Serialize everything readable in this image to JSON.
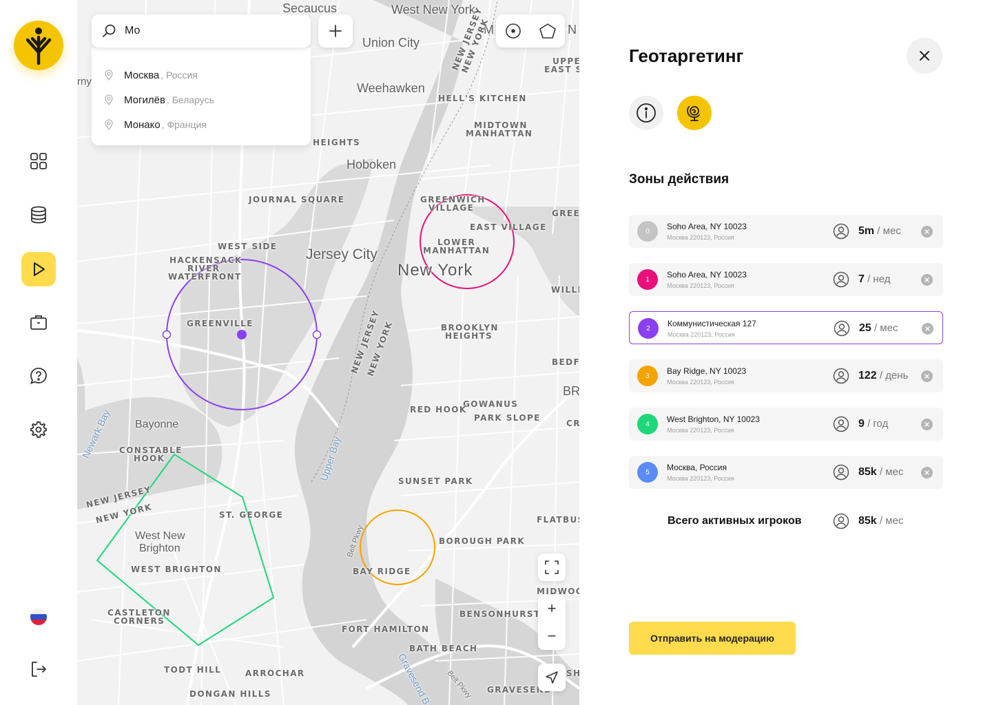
{
  "sidebar": {
    "logo": "app-logo",
    "items": [
      {
        "icon": "grid-icon",
        "active": false
      },
      {
        "icon": "database-icon",
        "active": false
      },
      {
        "icon": "play-icon",
        "active": true
      },
      {
        "icon": "briefcase-icon",
        "active": false
      },
      {
        "icon": "help-chat-icon",
        "active": false
      },
      {
        "icon": "gear-icon",
        "active": false
      }
    ],
    "language_flag": "flag-ru-icon",
    "logout": "logout-icon"
  },
  "map": {
    "search": {
      "value": "Мо",
      "placeholder": ""
    },
    "suggestions": [
      {
        "name": "Москва",
        "country": ", Россия"
      },
      {
        "name": "Могилёв",
        "country": ", Беларусь"
      },
      {
        "name": "Монако",
        "country": ", Франция"
      }
    ],
    "labels": {
      "secaucus": "Secaucus",
      "west_new_york": "West New York",
      "union_city": "Union City",
      "weehawken": "Weehawken",
      "hoboken": "Hoboken",
      "journal_square": "JOURNAL SQUARE",
      "west_side": "WEST SIDE",
      "jersey_city": "Jersey City",
      "hackensack": "HACKENSACK",
      "river": "RIVER",
      "waterfront": "WATERFRONT",
      "greenville": "GREENVILLE",
      "bayonne": "Bayonne",
      "constable": "CONSTABLE",
      "hook": "HOOK",
      "new_jersey_left": "NEW JERSEY",
      "new_york_left": "NEW YORK",
      "st_george": "ST. GEORGE",
      "west_new": "West New",
      "brighton": "Brighton",
      "west_brighton": "WEST BRIGHTON",
      "castleton": "CASTLETON",
      "corners": "CORNERS",
      "todt_hill": "TODT HILL",
      "arrochar": "ARROCHAR",
      "dongan_hills": "DONGAN HILLS",
      "new_york_city": "New York",
      "greenwich": "GREENWICH",
      "village": "VILLAGE",
      "east_village": "EAST VILLAGE",
      "lower": "LOWER",
      "manhattan": "MANHATTAN",
      "hells_kitchen": "HELL'S KITCHEN",
      "midtown": "MIDTOWN",
      "midtown_manhattan": "MANHATTAN",
      "heights_top": "HEIGHTS",
      "williamsburg": "WILLIAMSB",
      "brooklyn": "BROOKLYN",
      "heights": "HEIGHTS",
      "bedford": "BEDFO",
      "br": "BR",
      "gowanus": "GOWANUS",
      "park_slope": "PARK SLOPE",
      "red_hook": "RED HOOK",
      "cr": "CR",
      "sunset_park": "SUNSET PARK",
      "flatbush": "FLATBUSH",
      "borough_park": "BOROUGH PARK",
      "bay_ridge": "BAY RIDGE",
      "midwood": "MIDWOOD",
      "bensonhurst": "BENSONHURST",
      "fort_hamilton": "FORT HAMILTON",
      "bath_beach": "BATH BEACH",
      "gravesend": "GRAVESEND",
      "sh": "SH",
      "green": "GREEN",
      "upper": "UPPER",
      "east_side": "EAST SIDE",
      "m": "M",
      "n": "N",
      "rny": "rny",
      "nj_ny_top_1": "NEW JERSEY",
      "nj_ny_top_2": "NEW YORK",
      "nj_ny_mid_1": "NEW JERSEY",
      "nj_ny_mid_2": "NEW YORK",
      "newark_bay": "Newark Bay",
      "upper_bay": "Upper Bay",
      "belt_pkwy": "Belt Pkwy",
      "belt_pkwy_2": "Belt Pkwy",
      "gravesend_bay": "Gravesend B"
    },
    "zoom_in": "+",
    "zoom_out": "−"
  },
  "panel": {
    "title": "Геотаргетинг",
    "section_title": "Зоны действия",
    "zones": [
      {
        "num": "0",
        "color": "#c4c4c4",
        "name": "Soho Area, NY 10023",
        "addr": "Москва 220123,  Россия",
        "count": "5m",
        "period": " / мес",
        "selected": false
      },
      {
        "num": "1",
        "color": "#e8107a",
        "name": "Soho Area, NY 10023",
        "addr": "Москва 220123,  Россия",
        "count": "7",
        "period": " / нед",
        "selected": false
      },
      {
        "num": "2",
        "color": "#8a3ff0",
        "name": "Коммунистическая 127",
        "addr": "Москва 220123,  Россия",
        "count": "25",
        "period": " / мес",
        "selected": true
      },
      {
        "num": "3",
        "color": "#f5a300",
        "name": "Bay Ridge, NY 10023",
        "addr": "Москва 220123,  Россия",
        "count": "122",
        "period": " / день",
        "selected": false
      },
      {
        "num": "4",
        "color": "#1fd67a",
        "name": "West Brighton, NY 10023",
        "addr": "Москва 220123,  Россия",
        "count": "9",
        "period": " / год",
        "selected": false
      },
      {
        "num": "5",
        "color": "#5b8cf5",
        "name": "Москва, Россия",
        "addr": "Москва 220123,  Россия",
        "count": "85k",
        "period": " / мес",
        "selected": false
      }
    ],
    "total": {
      "label": "Всего активных игроков",
      "count": "85k",
      "period": " / мес"
    },
    "submit_label": "Отправить на модерацию"
  }
}
